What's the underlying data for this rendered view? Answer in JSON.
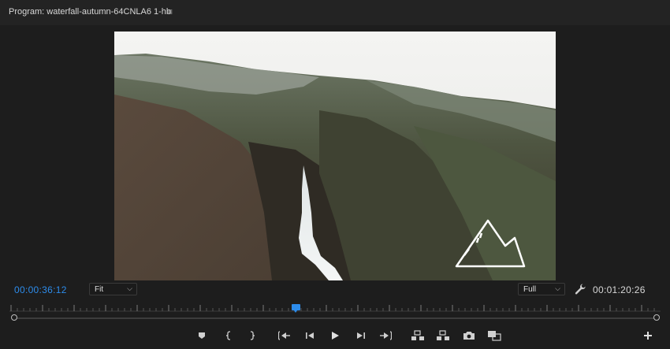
{
  "panel": {
    "title": "Program: waterfall-autumn-64CNLA6 1-hb",
    "menu_icon": "hamburger-menu-icon"
  },
  "footer": {
    "current_timecode": "00:00:36:12",
    "zoom_select": "Fit",
    "resolution_select": "Full",
    "duration_timecode": "00:01:20:26",
    "playhead_position": 0.44
  },
  "controls": [
    {
      "name": "add-marker-button",
      "icon": "marker-icon"
    },
    {
      "name": "mark-in-button",
      "icon": "mark-in-icon"
    },
    {
      "name": "mark-out-button",
      "icon": "mark-out-icon"
    },
    {
      "name": "go-to-in-button",
      "icon": "go-to-in-icon"
    },
    {
      "name": "step-back-button",
      "icon": "step-back-icon"
    },
    {
      "name": "play-button",
      "icon": "play-icon"
    },
    {
      "name": "step-forward-button",
      "icon": "step-forward-icon"
    },
    {
      "name": "go-to-out-button",
      "icon": "go-to-out-icon"
    },
    {
      "name": "lift-button",
      "icon": "lift-icon"
    },
    {
      "name": "extract-button",
      "icon": "extract-icon"
    },
    {
      "name": "export-frame-button",
      "icon": "camera-icon"
    },
    {
      "name": "comparison-view-button",
      "icon": "comparison-view-icon"
    },
    {
      "name": "button-editor-button",
      "icon": "plus-icon"
    }
  ],
  "colors": {
    "accent": "#2d8ceb",
    "background": "#1d1d1d"
  }
}
